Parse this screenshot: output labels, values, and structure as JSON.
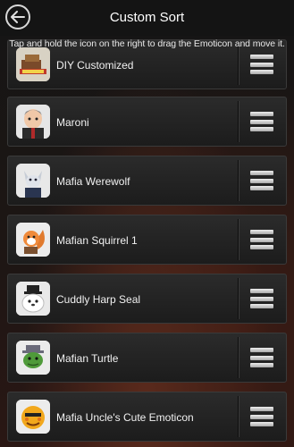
{
  "header": {
    "title": "Custom Sort",
    "back_icon": "back-arrow-icon"
  },
  "hint": "Tap and hold the icon on the right to drag the Emoticon and move it.",
  "items": [
    {
      "label": "DIY Customized",
      "icon": "diy-customized-emoticon-icon"
    },
    {
      "label": "Maroni",
      "icon": "maroni-emoticon-icon"
    },
    {
      "label": "Mafia Werewolf",
      "icon": "mafia-werewolf-emoticon-icon"
    },
    {
      "label": "Mafian Squirrel 1",
      "icon": "mafian-squirrel-emoticon-icon"
    },
    {
      "label": "Cuddly Harp Seal",
      "icon": "cuddly-harp-seal-emoticon-icon"
    },
    {
      "label": "Mafian Turtle",
      "icon": "mafian-turtle-emoticon-icon"
    },
    {
      "label": "Mafia Uncle's Cute Emoticon",
      "icon": "mafia-uncle-emoticon-icon"
    }
  ]
}
